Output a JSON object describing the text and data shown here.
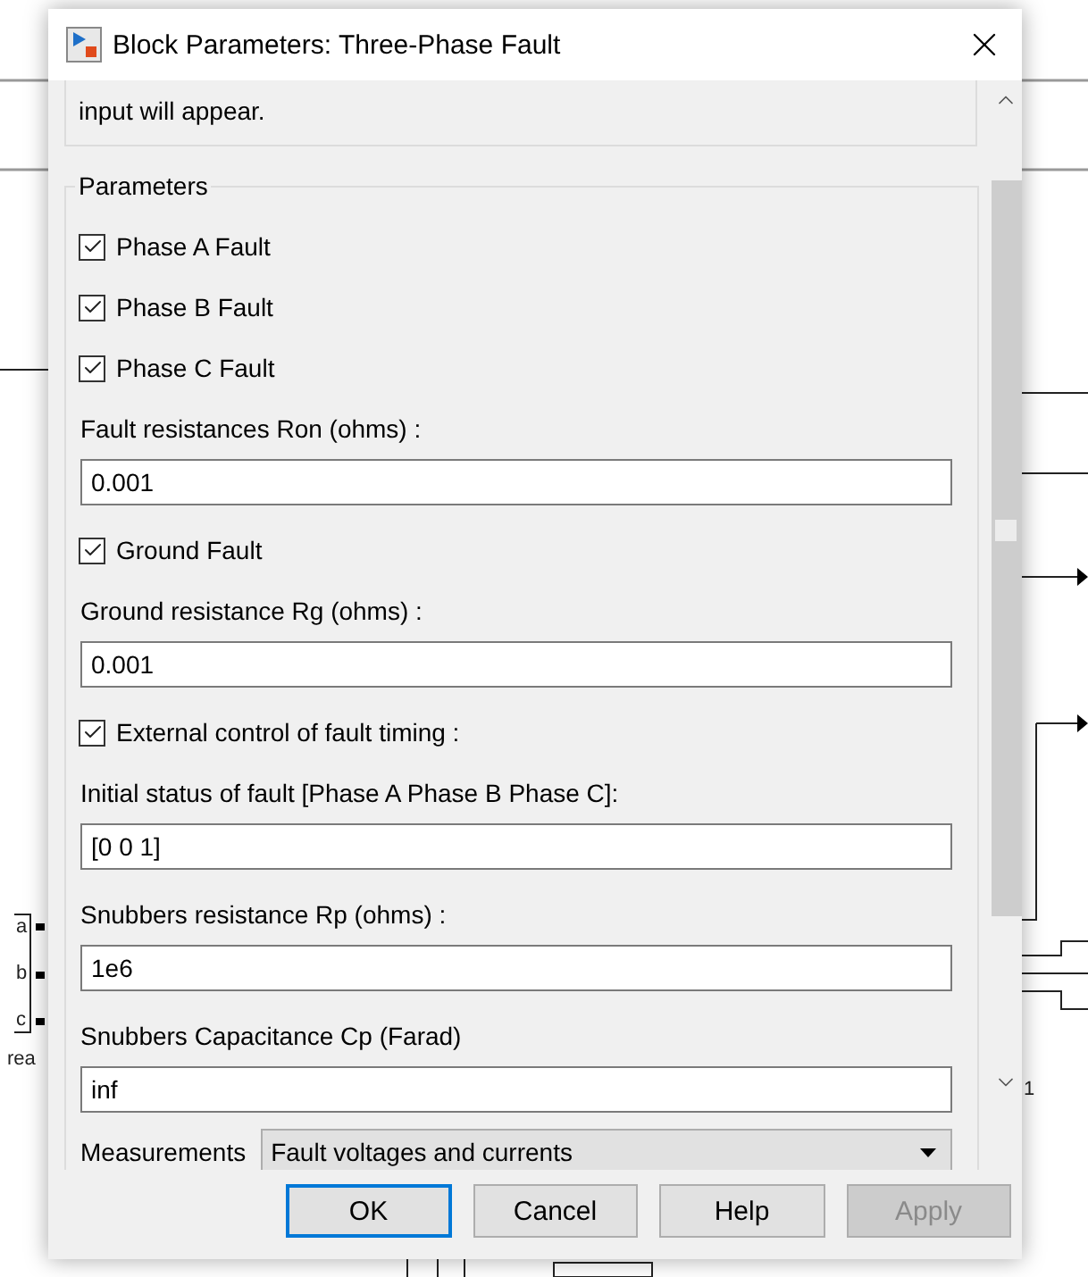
{
  "window": {
    "title": "Block Parameters: Three-Phase Fault"
  },
  "description": {
    "lines": [
      "input will appear."
    ]
  },
  "parameters": {
    "label": "Parameters",
    "items": [
      {
        "kind": "checkbox",
        "label": "Phase A Fault",
        "checked": true
      },
      {
        "kind": "checkbox",
        "label": "Phase B Fault",
        "checked": true
      },
      {
        "kind": "checkbox",
        "label": "Phase C Fault",
        "checked": true
      },
      {
        "kind": "field",
        "label": "Fault resistances  Ron (ohms) :",
        "value": "0.001"
      },
      {
        "kind": "checkbox",
        "label": "Ground Fault",
        "checked": true
      },
      {
        "kind": "field",
        "label": "Ground resistance Rg (ohms) :",
        "value": "0.001"
      },
      {
        "kind": "checkbox",
        "label": "External control of fault timing :",
        "checked": true
      },
      {
        "kind": "field",
        "label": "Initial status of fault [Phase A  Phase B  Phase C]:",
        "value": "[0 0 1]"
      },
      {
        "kind": "field",
        "label": "Snubbers resistance Rp (ohms) :",
        "value": "1e6"
      },
      {
        "kind": "field",
        "label": "Snubbers Capacitance Cp (Farad)",
        "value": "inf"
      },
      {
        "kind": "dropdown",
        "label": "Measurements",
        "value": "Fault voltages and currents"
      }
    ]
  },
  "buttons": [
    {
      "label": "OK",
      "default": true,
      "disabled": false
    },
    {
      "label": "Cancel",
      "default": false,
      "disabled": false
    },
    {
      "label": "Help",
      "default": false,
      "disabled": false
    },
    {
      "label": "Apply",
      "default": false,
      "disabled": true
    }
  ],
  "canvas": {
    "ports": [
      "a",
      "b",
      "c"
    ],
    "block_label": "rea",
    "side_label": "1"
  }
}
